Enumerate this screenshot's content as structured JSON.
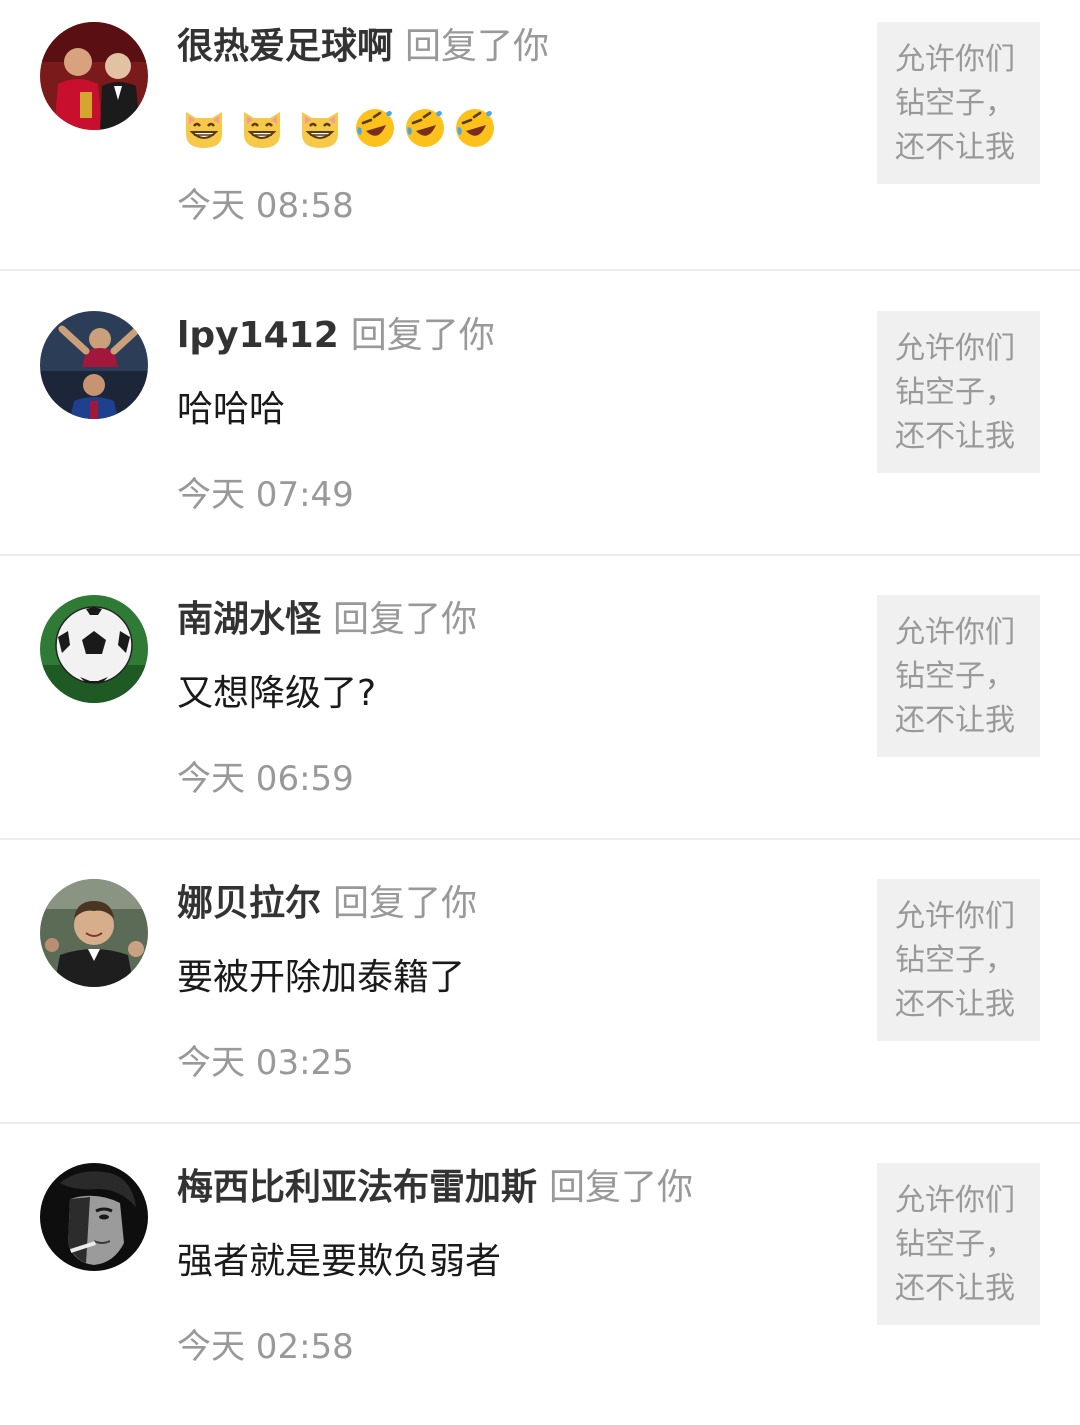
{
  "comments": [
    {
      "username": "很热爱足球啊",
      "action": "回复了你",
      "content": "",
      "emojis": [
        "grinning-cat-emoji",
        "grinning-cat-emoji",
        "grinning-cat-emoji",
        "rolling-laughing-emoji",
        "rolling-laughing-emoji",
        "rolling-laughing-emoji"
      ],
      "time": "今天 08:58",
      "quote": "允许你们\n钻空子，\n还不让我"
    },
    {
      "username": "lpy1412",
      "action": "回复了你",
      "content": "哈哈哈",
      "time": "今天 07:49",
      "quote": "允许你们\n钻空子，\n还不让我"
    },
    {
      "username": "南湖水怪",
      "action": "回复了你",
      "content": "又想降级了?",
      "time": "今天 06:59",
      "quote": "允许你们\n钻空子，\n还不让我"
    },
    {
      "username": "娜贝拉尔",
      "action": "回复了你",
      "content": "要被开除加泰籍了",
      "time": "今天 03:25",
      "quote": "允许你们\n钻空子，\n还不让我"
    },
    {
      "username": "梅西比利亚法布雷加斯",
      "action": "回复了你",
      "content": "强者就是要欺负弱者",
      "time": "今天 02:58",
      "quote": "允许你们\n钻空子，\n还不让我"
    }
  ],
  "colors": {
    "username": "#333333",
    "secondary_text": "#999999",
    "quote_background": "#f0f0f0",
    "divider": "#ededed"
  }
}
